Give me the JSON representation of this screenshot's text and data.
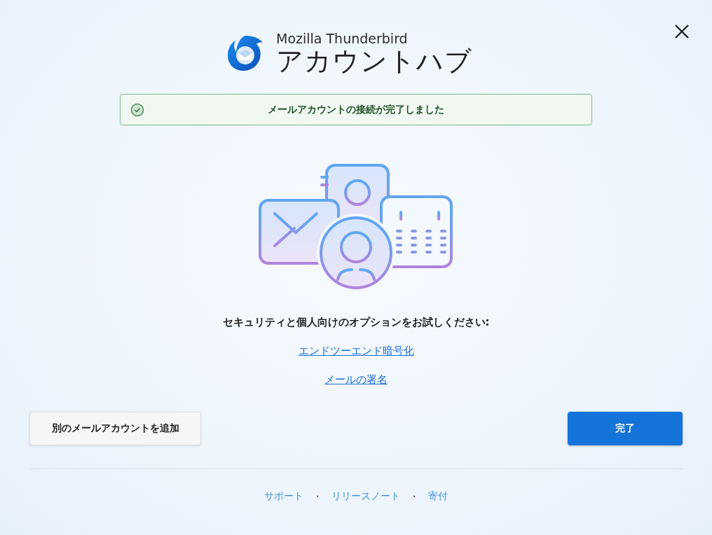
{
  "header": {
    "brand": "Mozilla Thunderbird",
    "title": "アカウントハブ"
  },
  "banner": {
    "message": "メールアカウントの接続が完了しました"
  },
  "prompt": "セキュリティと個人向けのオプションをお試しください:",
  "option_links": [
    "エンドツーエンド暗号化",
    "メールの署名"
  ],
  "buttons": [
    {
      "label": "別のメールアカウントを追加",
      "kind": "secondary"
    },
    {
      "label": "完了",
      "kind": "primary"
    }
  ],
  "footer": {
    "separator": "・",
    "links": [
      "サポート",
      "リリースノート",
      "寄付"
    ]
  }
}
